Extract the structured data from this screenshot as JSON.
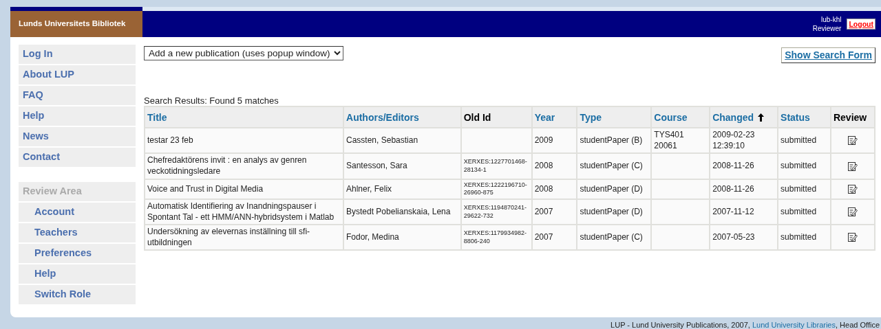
{
  "header": {
    "library": "Lunds Universitets Bibliotek",
    "user": "lub-khl",
    "role": "Reviewer",
    "logout": "Logout"
  },
  "sidebar": {
    "items": [
      {
        "label": "Log In"
      },
      {
        "label": "About LUP"
      },
      {
        "label": "FAQ"
      },
      {
        "label": "Help"
      },
      {
        "label": "News"
      },
      {
        "label": "Contact"
      }
    ],
    "sections": [
      {
        "label": "Review Area",
        "disabled": true,
        "children": [
          {
            "label": "Account"
          },
          {
            "label": "Teachers"
          },
          {
            "label": "Preferences"
          },
          {
            "label": "Help"
          },
          {
            "label": "Switch Role"
          }
        ]
      }
    ]
  },
  "add_select": {
    "value": "Add a new publication (uses popup window)"
  },
  "search_toggle": "Show Search Form",
  "results_summary": "Search Results: Found 5 matches",
  "table": {
    "columns": [
      {
        "label": "Title",
        "sortable": true,
        "sorted": false
      },
      {
        "label": "Authors/Editors",
        "sortable": true,
        "sorted": false
      },
      {
        "label": "Old Id",
        "sortable": false,
        "sorted": false
      },
      {
        "label": "Year",
        "sortable": true,
        "sorted": false
      },
      {
        "label": "Type",
        "sortable": true,
        "sorted": false
      },
      {
        "label": "Course",
        "sortable": true,
        "sorted": false
      },
      {
        "label": "Changed",
        "sortable": true,
        "sorted": true
      },
      {
        "label": "Status",
        "sortable": true,
        "sorted": false
      },
      {
        "label": "Review",
        "sortable": false,
        "sorted": false
      }
    ],
    "rows": [
      {
        "title": "testar 23 feb",
        "authors": "Cassten, Sebastian",
        "old_id": "",
        "year": "2009",
        "type": "studentPaper (B)",
        "course": "TYS401 20061",
        "changed": "2009-02-23 12:39:10",
        "status": "submitted"
      },
      {
        "title": "Chefredaktörens invit : en analys av genren veckotidningsledare",
        "authors": "Santesson, Sara",
        "old_id": "XERXES:1227701468-28134-1",
        "year": "2008",
        "type": "studentPaper (C)",
        "course": "",
        "changed": "2008-11-26",
        "status": "submitted"
      },
      {
        "title": "Voice and Trust in Digital Media",
        "authors": "Ahlner, Felix",
        "old_id": "XERXES:1222196710-26960-875",
        "year": "2008",
        "type": "studentPaper (D)",
        "course": "",
        "changed": "2008-11-26",
        "status": "submitted"
      },
      {
        "title": "Automatisk Identifiering av Inandningspauser i Spontant Tal - ett HMM/ANN-hybridsystem i Matlab",
        "authors": "Bystedt Pobelianskaia, Lena",
        "old_id": "XERXES:1194870241-29622-732",
        "year": "2007",
        "type": "studentPaper (D)",
        "course": "",
        "changed": "2007-11-12",
        "status": "submitted"
      },
      {
        "title": "Undersökning av elevernas inställning till sfi-utbildningen",
        "authors": "Fodor, Medina",
        "old_id": "XERXES:1179934982-8806-240",
        "year": "2007",
        "type": "studentPaper (C)",
        "course": "",
        "changed": "2007-05-23",
        "status": "submitted"
      }
    ]
  },
  "footer": {
    "text": "LUP - Lund University Publications, 2007,",
    "link": "Lund University Libraries",
    "suffix": ", Head Office"
  }
}
